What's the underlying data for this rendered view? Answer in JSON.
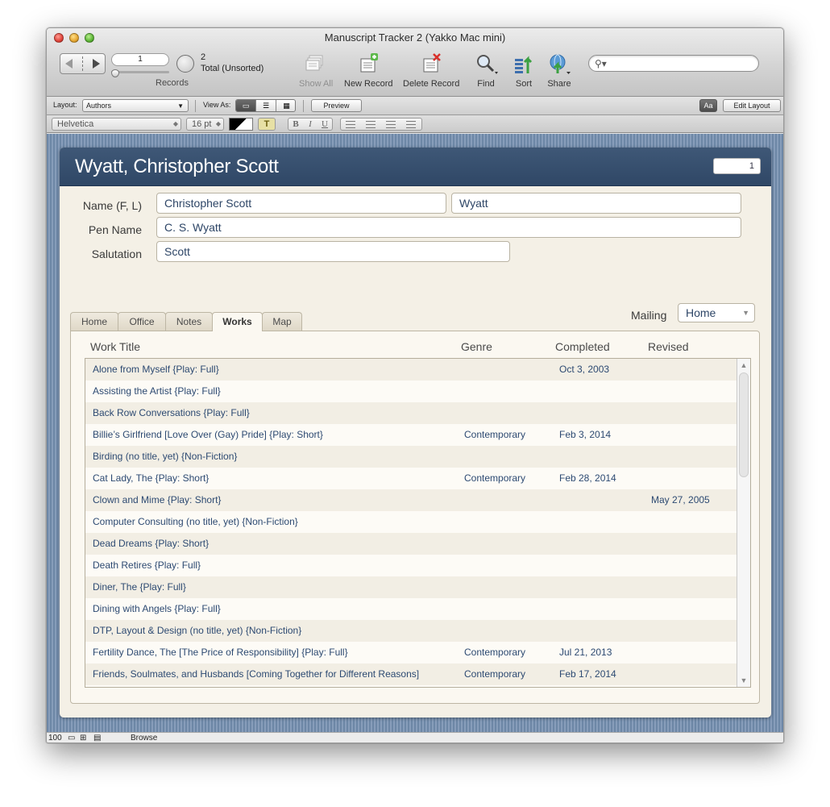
{
  "window": {
    "title": "Manuscript Tracker 2 (Yakko Mac mini)"
  },
  "toolbar": {
    "record_number": "1",
    "found_count": "2",
    "total_label": "Total (Unsorted)",
    "records_label": "Records",
    "show_all": "Show All",
    "new_record": "New Record",
    "delete_record": "Delete Record",
    "find": "Find",
    "sort": "Sort",
    "share": "Share",
    "search_placeholder": ""
  },
  "layout_bar": {
    "layout_label": "Layout:",
    "layout_value": "Authors",
    "view_as_label": "View As:",
    "preview": "Preview",
    "aa": "Aa",
    "edit_layout": "Edit Layout"
  },
  "format_bar": {
    "font": "Helvetica",
    "size": "16 pt",
    "text_color_btn": "T",
    "bold": "B",
    "italic": "I",
    "underline": "U"
  },
  "record": {
    "header_name": "Wyatt, Christopher Scott",
    "record_badge": "1",
    "name_label": "Name (F, L)",
    "first_name": "Christopher Scott",
    "last_name": "Wyatt",
    "pen_name_label": "Pen Name",
    "pen_name": "C. S. Wyatt",
    "salutation_label": "Salutation",
    "salutation": "Scott"
  },
  "tabs": [
    {
      "label": "Home"
    },
    {
      "label": "Office"
    },
    {
      "label": "Notes"
    },
    {
      "label": "Works"
    },
    {
      "label": "Map"
    }
  ],
  "active_tab": "Works",
  "mailing": {
    "label": "Mailing",
    "value": "Home"
  },
  "works": {
    "columns": {
      "title": "Work Title",
      "genre": "Genre",
      "completed": "Completed",
      "revised": "Revised"
    },
    "rows": [
      {
        "title": "Alone from Myself {Play: Full}",
        "genre": "",
        "completed": "Oct 3, 2003",
        "revised": ""
      },
      {
        "title": "Assisting the Artist {Play: Full}",
        "genre": "",
        "completed": "",
        "revised": ""
      },
      {
        "title": "Back Row Conversations {Play: Full}",
        "genre": "",
        "completed": "",
        "revised": ""
      },
      {
        "title": "Billie’s Girlfriend [Love Over (Gay) Pride] {Play: Short}",
        "genre": "Contemporary",
        "completed": "Feb 3, 2014",
        "revised": ""
      },
      {
        "title": "Birding (no title, yet) {Non-Fiction}",
        "genre": "",
        "completed": "",
        "revised": ""
      },
      {
        "title": "Cat Lady, The {Play: Short}",
        "genre": "Contemporary",
        "completed": "Feb 28, 2014",
        "revised": ""
      },
      {
        "title": "Clown and Mime {Play: Short}",
        "genre": "",
        "completed": "",
        "revised": "May 27, 2005"
      },
      {
        "title": "Computer Consulting (no title, yet) {Non-Fiction}",
        "genre": "",
        "completed": "",
        "revised": ""
      },
      {
        "title": "Dead Dreams {Play: Short}",
        "genre": "",
        "completed": "",
        "revised": ""
      },
      {
        "title": "Death Retires {Play: Full}",
        "genre": "",
        "completed": "",
        "revised": ""
      },
      {
        "title": "Diner, The {Play: Full}",
        "genre": "",
        "completed": "",
        "revised": ""
      },
      {
        "title": "Dining with Angels {Play: Full}",
        "genre": "",
        "completed": "",
        "revised": ""
      },
      {
        "title": "DTP, Layout & Design (no title, yet) {Non-Fiction}",
        "genre": "",
        "completed": "",
        "revised": ""
      },
      {
        "title": "Fertility Dance, The [The Price of Responsibility] {Play: Full}",
        "genre": "Contemporary",
        "completed": "Jul 21, 2013",
        "revised": ""
      },
      {
        "title": "Friends, Soulmates, and Husbands [Coming Together for Different Reasons]",
        "genre": "Contemporary",
        "completed": "Feb 17, 2014",
        "revised": ""
      }
    ]
  },
  "status_bar": {
    "zoom": "100",
    "mode": "Browse"
  },
  "colors": {
    "header_bg": "#2f4766",
    "content_bg": "#6d87a6",
    "card_bg": "#f4f0e6",
    "link_text": "#2d4a72"
  },
  "icons": [
    "back-arrow-icon",
    "forward-arrow-icon",
    "pie-chart-icon",
    "show-all-icon",
    "new-record-icon",
    "delete-record-icon",
    "find-magnifier-icon",
    "sort-icon",
    "share-icon",
    "search-icon"
  ]
}
